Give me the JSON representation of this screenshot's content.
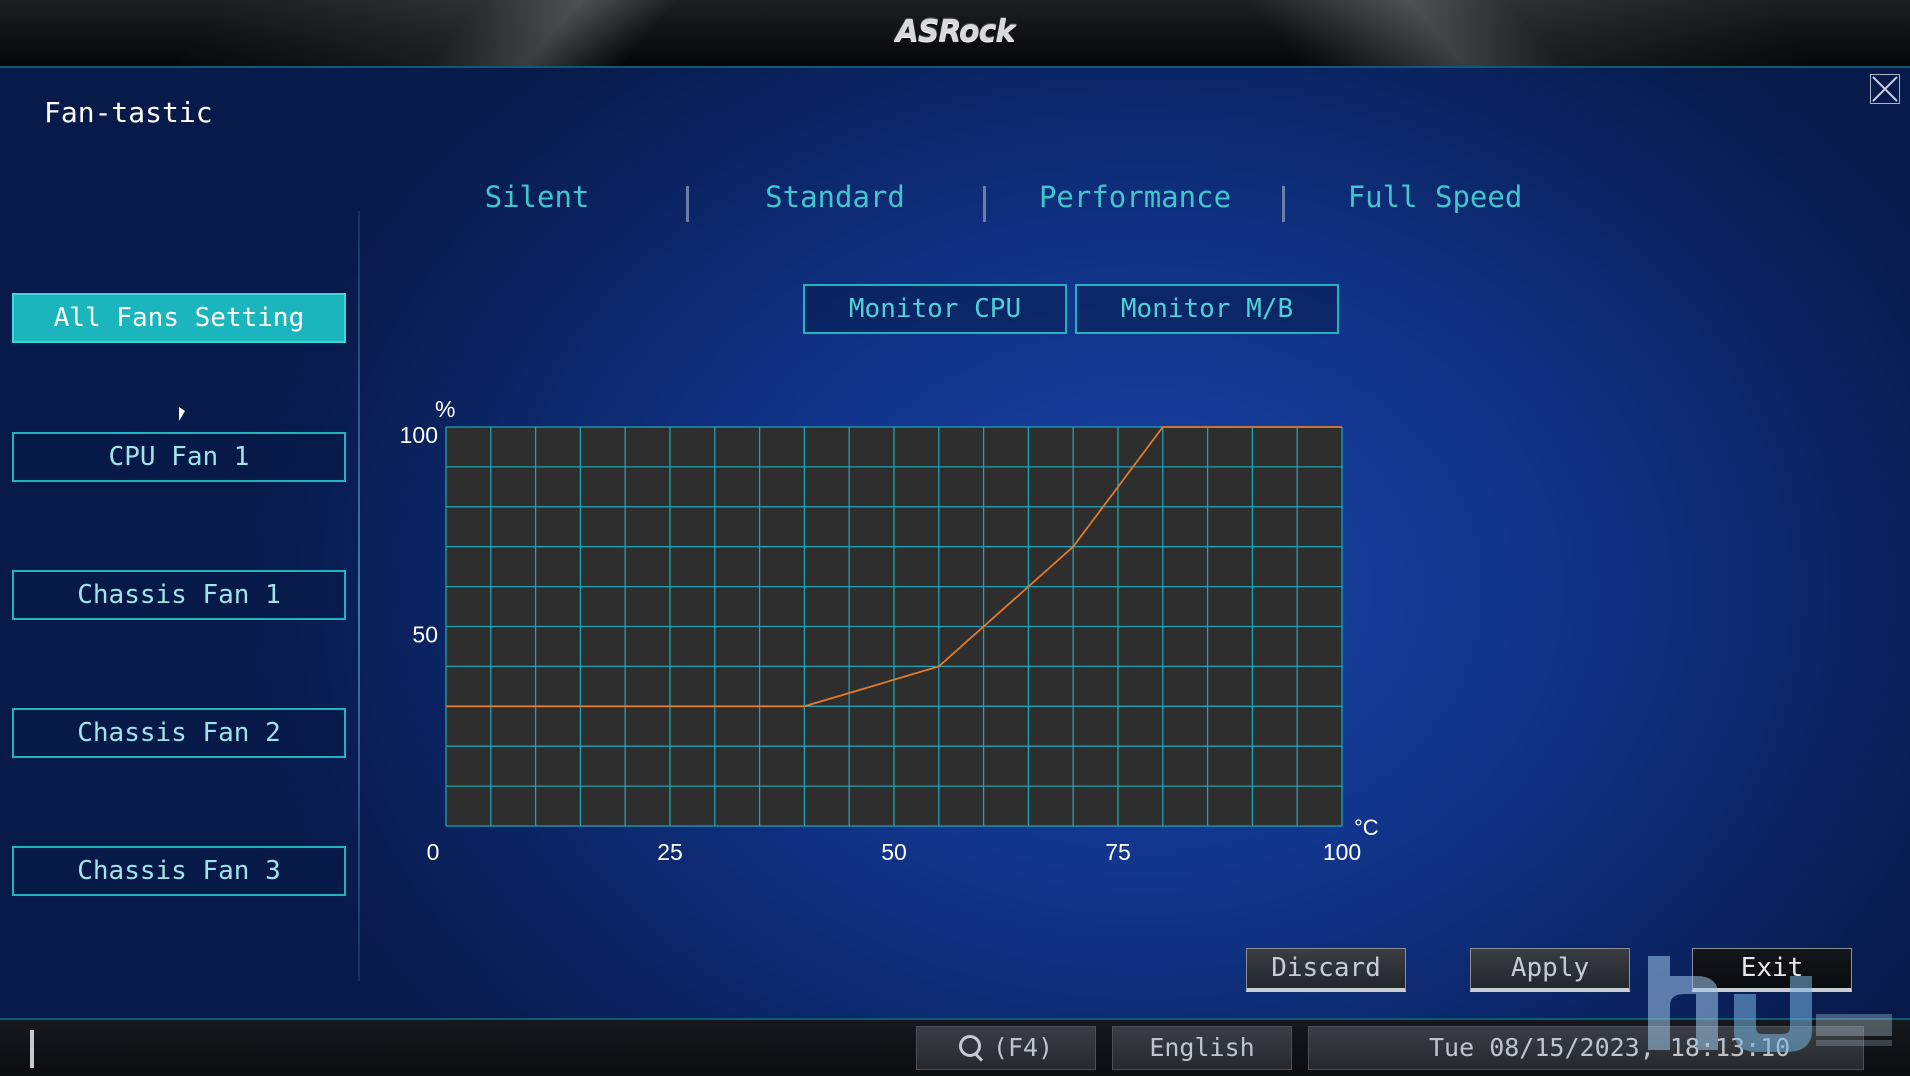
{
  "header": {
    "brand": "ASRock"
  },
  "page": {
    "title": "Fan-tastic"
  },
  "sidebar": {
    "items": [
      {
        "label": "All Fans Setting",
        "active": true
      },
      {
        "label": "CPU Fan 1",
        "active": false
      },
      {
        "label": "Chassis Fan 1",
        "active": false
      },
      {
        "label": "Chassis Fan 2",
        "active": false
      },
      {
        "label": "Chassis Fan 3",
        "active": false
      }
    ]
  },
  "profiles": {
    "tabs": [
      "Silent",
      "Standard",
      "Performance",
      "Full Speed"
    ]
  },
  "monitor": {
    "cpu_label": "Monitor CPU",
    "mb_label": "Monitor M/B"
  },
  "actions": {
    "discard": "Discard",
    "apply": "Apply",
    "exit": "Exit"
  },
  "statusbar": {
    "search_label": "(F4)",
    "language": "English",
    "datetime": "Tue 08/15/2023, 18:13:10"
  },
  "colors": {
    "accent": "#1bb6bd",
    "curve": "#e07a2e",
    "grid": "#1fa3b4",
    "chart_bg": "#2e2e2e"
  },
  "chart_data": {
    "type": "line",
    "title": "",
    "xlabel": "°C",
    "ylabel": "%",
    "xlim": [
      0,
      100
    ],
    "ylim": [
      0,
      100
    ],
    "x_ticks": [
      0,
      25,
      50,
      75,
      100
    ],
    "y_ticks": [
      0,
      50,
      100
    ],
    "grid": true,
    "series": [
      {
        "x": [
          0,
          40,
          55,
          70,
          80,
          100
        ],
        "y": [
          30,
          30,
          40,
          70,
          100,
          100
        ]
      }
    ]
  }
}
